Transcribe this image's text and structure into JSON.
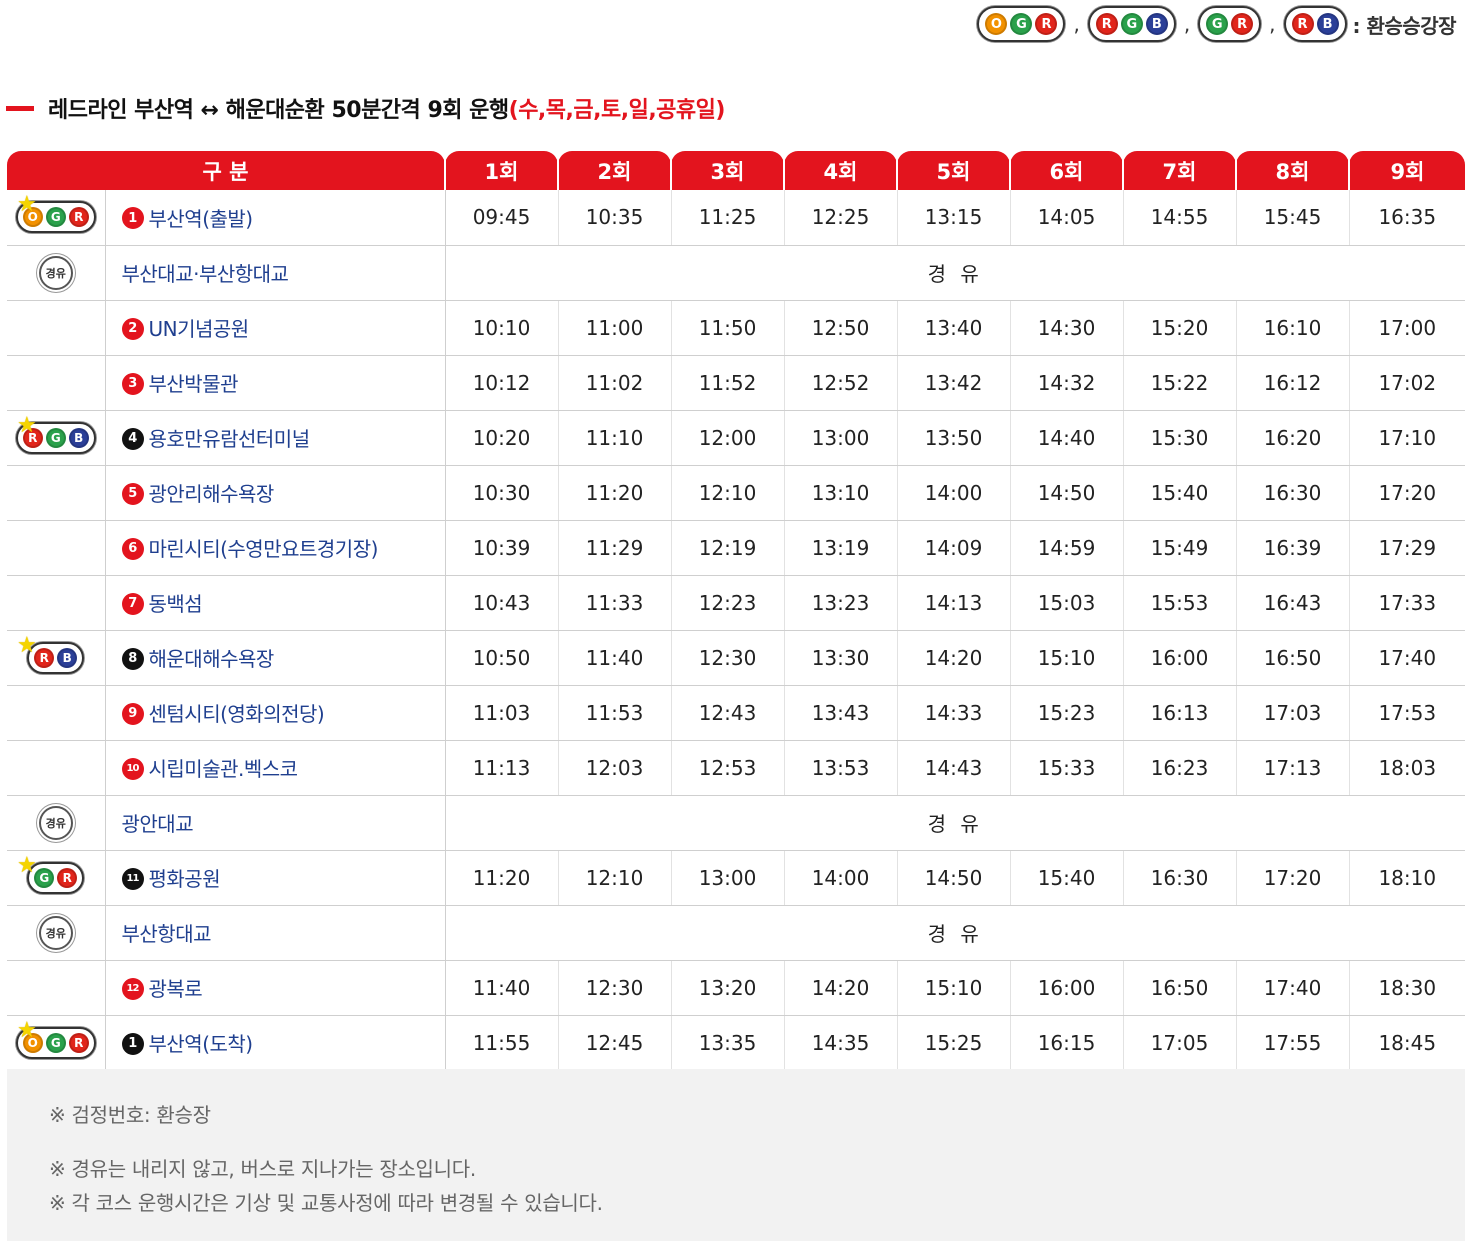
{
  "legend": {
    "badges": [
      [
        "O",
        "G",
        "R"
      ],
      [
        "R",
        "G",
        "B"
      ],
      [
        "G",
        "R"
      ],
      [
        "R",
        "B"
      ]
    ],
    "separator": ",",
    "label": ": 환승승강장"
  },
  "title": {
    "text": "레드라인 부산역 ↔ 해운대순환 50분간격 9회 운행",
    "days": "(수,목,금,토,일,공휴일)"
  },
  "table": {
    "header_label": "구 분",
    "runs": [
      "1회",
      "2회",
      "3회",
      "4회",
      "5회",
      "6회",
      "7회",
      "8회",
      "9회"
    ],
    "via_text": "경 유",
    "via_badge": "경유",
    "rows": [
      {
        "icon": "OGR",
        "num": "1",
        "num_color": "red",
        "stop": "부산역(출발)",
        "times": [
          "09:45",
          "10:35",
          "11:25",
          "12:25",
          "13:15",
          "14:05",
          "14:55",
          "15:45",
          "16:35"
        ]
      },
      {
        "icon": "via",
        "stop": "부산대교·부산항대교",
        "via": true
      },
      {
        "icon": "",
        "num": "2",
        "num_color": "red",
        "stop": "UN기념공원",
        "times": [
          "10:10",
          "11:00",
          "11:50",
          "12:50",
          "13:40",
          "14:30",
          "15:20",
          "16:10",
          "17:00"
        ]
      },
      {
        "icon": "",
        "num": "3",
        "num_color": "red",
        "stop": "부산박물관",
        "times": [
          "10:12",
          "11:02",
          "11:52",
          "12:52",
          "13:42",
          "14:32",
          "15:22",
          "16:12",
          "17:02"
        ]
      },
      {
        "icon": "RGB",
        "num": "4",
        "num_color": "black",
        "stop": "용호만유람선터미널",
        "times": [
          "10:20",
          "11:10",
          "12:00",
          "13:00",
          "13:50",
          "14:40",
          "15:30",
          "16:20",
          "17:10"
        ]
      },
      {
        "icon": "",
        "num": "5",
        "num_color": "red",
        "stop": "광안리해수욕장",
        "times": [
          "10:30",
          "11:20",
          "12:10",
          "13:10",
          "14:00",
          "14:50",
          "15:40",
          "16:30",
          "17:20"
        ]
      },
      {
        "icon": "",
        "num": "6",
        "num_color": "red",
        "stop": "마린시티(수영만요트경기장)",
        "times": [
          "10:39",
          "11:29",
          "12:19",
          "13:19",
          "14:09",
          "14:59",
          "15:49",
          "16:39",
          "17:29"
        ]
      },
      {
        "icon": "",
        "num": "7",
        "num_color": "red",
        "stop": "동백섬",
        "times": [
          "10:43",
          "11:33",
          "12:23",
          "13:23",
          "14:13",
          "15:03",
          "15:53",
          "16:43",
          "17:33"
        ]
      },
      {
        "icon": "RB",
        "num": "8",
        "num_color": "black",
        "stop": "해운대해수욕장",
        "times": [
          "10:50",
          "11:40",
          "12:30",
          "13:30",
          "14:20",
          "15:10",
          "16:00",
          "16:50",
          "17:40"
        ]
      },
      {
        "icon": "",
        "num": "9",
        "num_color": "red",
        "stop": "센텀시티(영화의전당)",
        "times": [
          "11:03",
          "11:53",
          "12:43",
          "13:43",
          "14:33",
          "15:23",
          "16:13",
          "17:03",
          "17:53"
        ]
      },
      {
        "icon": "",
        "num": "10",
        "num_color": "red",
        "stop": "시립미술관.벡스코",
        "times": [
          "11:13",
          "12:03",
          "12:53",
          "13:53",
          "14:43",
          "15:33",
          "16:23",
          "17:13",
          "18:03"
        ]
      },
      {
        "icon": "via",
        "stop": "광안대교",
        "via": true
      },
      {
        "icon": "GR",
        "num": "11",
        "num_color": "black",
        "stop": "평화공원",
        "times": [
          "11:20",
          "12:10",
          "13:00",
          "14:00",
          "14:50",
          "15:40",
          "16:30",
          "17:20",
          "18:10"
        ]
      },
      {
        "icon": "via",
        "stop": "부산항대교",
        "via": true
      },
      {
        "icon": "",
        "num": "12",
        "num_color": "red",
        "stop": "광복로",
        "times": [
          "11:40",
          "12:30",
          "13:20",
          "14:20",
          "15:10",
          "16:00",
          "16:50",
          "17:40",
          "18:30"
        ]
      },
      {
        "icon": "OGR",
        "num": "1",
        "num_color": "black",
        "stop": "부산역(도착)",
        "times": [
          "11:55",
          "12:45",
          "13:35",
          "14:35",
          "15:25",
          "16:15",
          "17:05",
          "17:55",
          "18:45"
        ]
      }
    ]
  },
  "notes": {
    "n1": "※ 검정번호: 환승장",
    "n2": "※ 경유는 내리지 않고, 버스로 지나가는 장소입니다.",
    "n3": "※ 각 코스 운행시간은 기상 및 교통사정에 따라 변경될 수 있습니다."
  },
  "colors": {
    "accent": "#e3141e",
    "stop_text": "#1f3f8f",
    "dot_O": "#f29100",
    "dot_G": "#2aa14b",
    "dot_R": "#e1251b",
    "dot_B": "#2b3f98"
  }
}
